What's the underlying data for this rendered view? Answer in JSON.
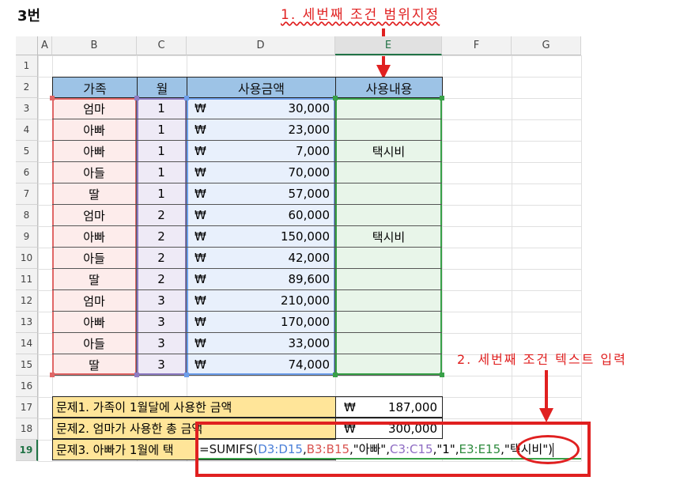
{
  "title_label": "3번",
  "annotations": {
    "top": "1. 세번째 조건 범위지정",
    "right": "2. 세번째 조건 텍스트 입력"
  },
  "columns": [
    "A",
    "B",
    "C",
    "D",
    "E",
    "F",
    "G"
  ],
  "rows": [
    "1",
    "2",
    "3",
    "4",
    "5",
    "6",
    "7",
    "8",
    "9",
    "10",
    "11",
    "12",
    "13",
    "14",
    "15",
    "16",
    "17",
    "18",
    "19"
  ],
  "table": {
    "headers": {
      "family": "가족",
      "month": "월",
      "amount": "사용금액",
      "usage": "사용내용"
    },
    "currency": "₩",
    "rows": [
      {
        "family": "엄마",
        "month": "1",
        "amount": "30,000",
        "usage": ""
      },
      {
        "family": "아빠",
        "month": "1",
        "amount": "23,000",
        "usage": ""
      },
      {
        "family": "아빠",
        "month": "1",
        "amount": "7,000",
        "usage": "택시비"
      },
      {
        "family": "아들",
        "month": "1",
        "amount": "70,000",
        "usage": ""
      },
      {
        "family": "딸",
        "month": "1",
        "amount": "57,000",
        "usage": ""
      },
      {
        "family": "엄마",
        "month": "2",
        "amount": "60,000",
        "usage": ""
      },
      {
        "family": "아빠",
        "month": "2",
        "amount": "150,000",
        "usage": "택시비"
      },
      {
        "family": "아들",
        "month": "2",
        "amount": "42,000",
        "usage": ""
      },
      {
        "family": "딸",
        "month": "2",
        "amount": "89,600",
        "usage": ""
      },
      {
        "family": "엄마",
        "month": "3",
        "amount": "210,000",
        "usage": ""
      },
      {
        "family": "아빠",
        "month": "3",
        "amount": "170,000",
        "usage": ""
      },
      {
        "family": "아들",
        "month": "3",
        "amount": "33,000",
        "usage": ""
      },
      {
        "family": "딸",
        "month": "3",
        "amount": "74,000",
        "usage": ""
      }
    ]
  },
  "questions": {
    "q1": {
      "text": "문제1. 가족이 1월달에 사용한 금액",
      "value": "187,000"
    },
    "q2": {
      "text": "문제2. 엄마가 사용한 총 금액",
      "value": "300,000"
    },
    "q3": {
      "text": "문제3. 아빠가 1월에 택"
    }
  },
  "formula": {
    "prefix": "=SUMIFS(",
    "r1": "D3:D15",
    "s1": ",",
    "r2": "B3:B15",
    "s2": ",\"아빠\",",
    "r3": "C3:C15",
    "s3": ",\"1\",",
    "r4": "E3:E15",
    "s4": ",\"",
    "crit": "택시비",
    "s5": "\")"
  },
  "colors": {
    "family_range": "#e06666",
    "month_range": "#8e7cc3",
    "amount_range": "#6d9eeb",
    "usage_range": "#38a048",
    "annotation": "#e02020",
    "header_fill": "#9dc3e6",
    "question_fill": "#ffe599"
  }
}
